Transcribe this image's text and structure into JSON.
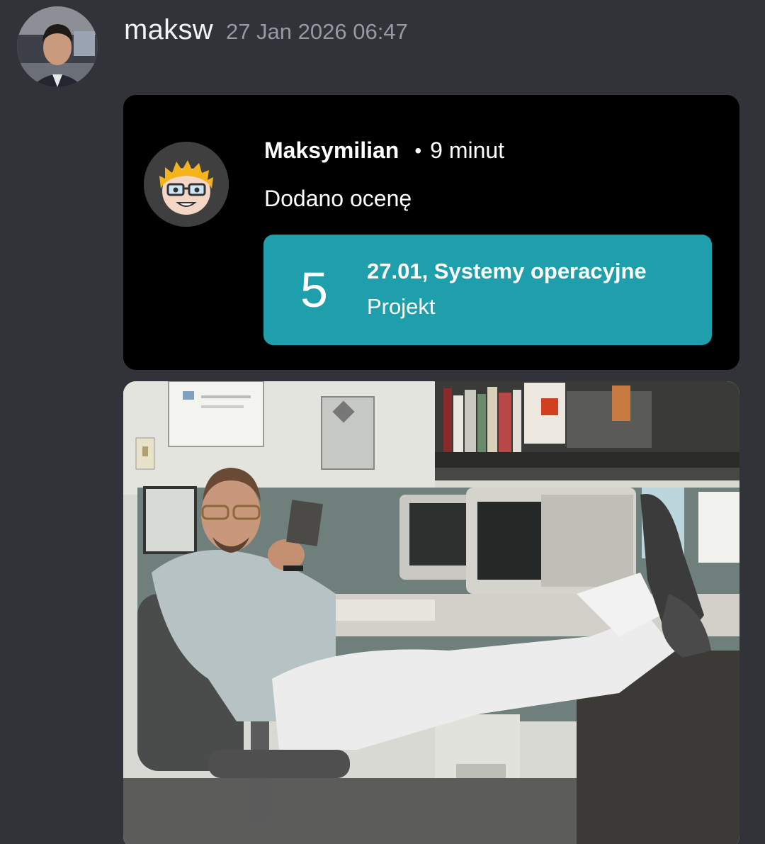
{
  "message": {
    "username": "maksw",
    "timestamp": "27 Jan 2026 06:47"
  },
  "notification": {
    "author": "Maksymilian",
    "separator": "•",
    "time_ago": "9 minut",
    "text": "Dodano ocenę",
    "grade": {
      "value": "5",
      "title": "27.01, Systemy operacyjne",
      "type": "Projekt"
    },
    "accent_color": "#1e9fab"
  },
  "attachment": {
    "kind": "photo",
    "subject": "man-reclining-at-office-desk"
  }
}
